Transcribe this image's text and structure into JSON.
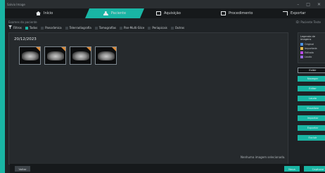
{
  "window": {
    "title": "Salvio Image",
    "controls": [
      "–",
      "□",
      "✕"
    ]
  },
  "nav": {
    "tabs": [
      {
        "label": "Início",
        "icon": "home-icon",
        "active": false
      },
      {
        "label": "Paciente",
        "icon": "user-icon",
        "active": true
      },
      {
        "label": "Aquisição",
        "icon": "acquisition-icon",
        "active": false
      },
      {
        "label": "Procedimento",
        "icon": "procedure-icon",
        "active": false
      },
      {
        "label": "Exportar",
        "icon": "export-icon",
        "active": false
      }
    ]
  },
  "subbar": {
    "left": "Exames do paciente",
    "right": "ID: Paciente Teste"
  },
  "filters": {
    "label": "Filtros",
    "items": [
      {
        "label": "Todos",
        "checked": true
      },
      {
        "label": "Panorâmica",
        "checked": false
      },
      {
        "label": "Telerradiografia",
        "checked": false
      },
      {
        "label": "Tomografias",
        "checked": false
      },
      {
        "label": "Pan-Multi-Slice",
        "checked": false
      },
      {
        "label": "Periapicais",
        "checked": false
      },
      {
        "label": "Outros",
        "checked": false
      }
    ]
  },
  "content": {
    "date": "20/12/2023",
    "thumbnails": [
      {
        "type": "panoramic",
        "tag_color": "#d98a3b"
      },
      {
        "type": "panoramic",
        "tag_color": "#d98a3b"
      },
      {
        "type": "panoramic",
        "tag_color": "#d98a3b"
      },
      {
        "type": "panoramic",
        "tag_color": "#d98a3b"
      }
    ],
    "selection_info": "Nenhuma imagem selecionada."
  },
  "legend": {
    "title": "Legenda de imagens",
    "items": [
      {
        "label": "Original",
        "color": "#4a90e2"
      },
      {
        "label": "Importada",
        "color": "#e2b84a"
      },
      {
        "label": "Editada",
        "color": "#b84ae2"
      },
      {
        "label": "Laudo",
        "color": "#9a6ae2"
      }
    ]
  },
  "sidebar_buttons": [
    "Exibir",
    "Navegar",
    "Editar",
    "Laudo",
    "Visualizar",
    "Importar",
    "Exportar",
    "Excluir"
  ],
  "footer": {
    "back": "Voltar",
    "mini": "Nova",
    "capture": "Capturar"
  },
  "colors": {
    "accent": "#19b5a4",
    "background": "#1f2326"
  }
}
